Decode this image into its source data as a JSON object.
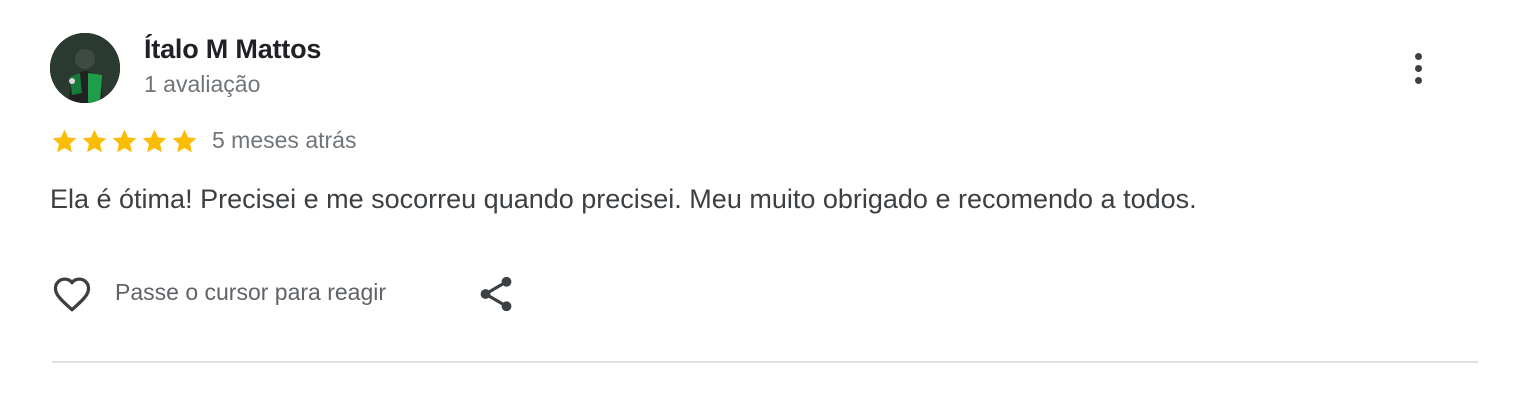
{
  "review": {
    "author": {
      "name": "Ítalo M Mattos",
      "reviews_count": "1 avaliação",
      "avatar_icon": "profile-photo"
    },
    "rating": 5,
    "rating_max": 5,
    "time_ago": "5 meses atrás",
    "text": "Ela é ótima! Precisei e me socorreu quando precisei. Meu muito obrigado e recomendo a todos.",
    "actions": {
      "react_label": "Passe o cursor para reagir",
      "heart_icon": "heart-outline-icon",
      "share_icon": "share-icon",
      "more_icon": "more-vert-icon"
    }
  },
  "colors": {
    "star": "#fbbc04",
    "name": "#202124",
    "secondary": "#70757a",
    "body_text": "#3c4043",
    "divider": "#e0e0e0"
  }
}
